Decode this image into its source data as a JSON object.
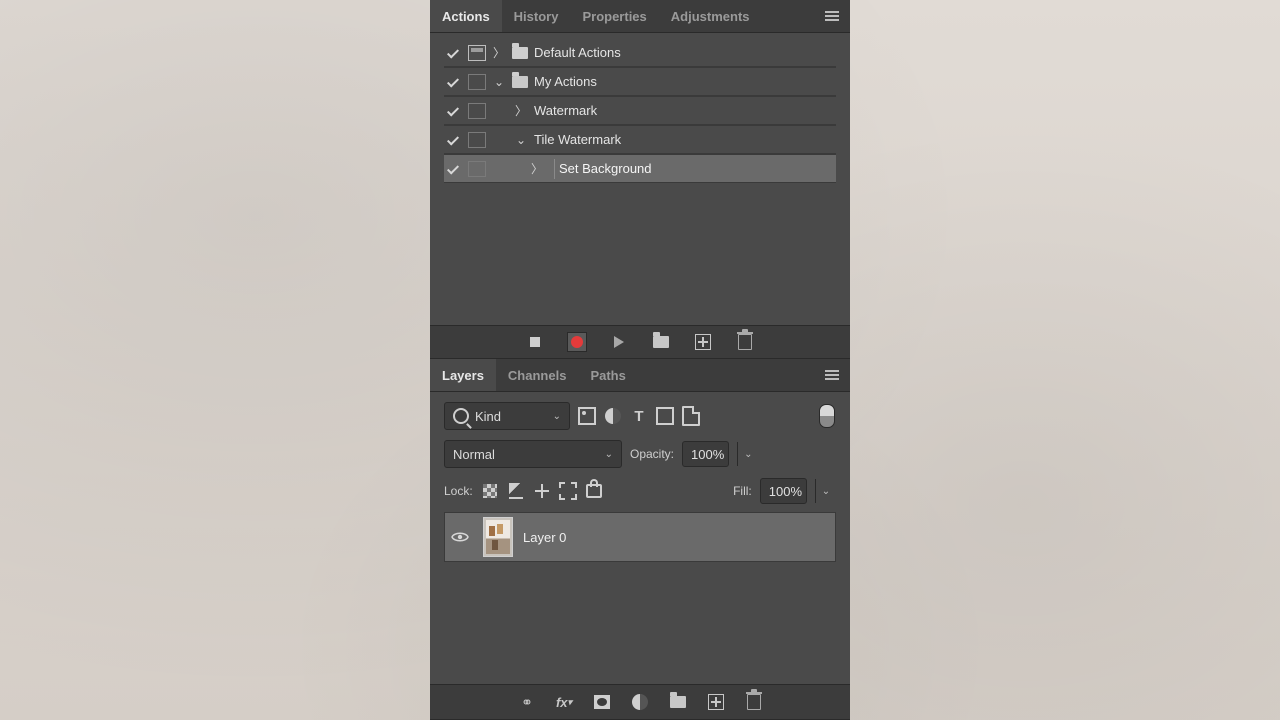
{
  "actions_panel": {
    "tabs": [
      "Actions",
      "History",
      "Properties",
      "Adjustments"
    ],
    "active_tab": "Actions",
    "tree": {
      "default_set": "Default Actions",
      "my_set": "My Actions",
      "watermark": "Watermark",
      "tile_watermark": "Tile Watermark",
      "set_background": "Set Background"
    },
    "footer_icons": [
      "stop",
      "record",
      "play",
      "new-set",
      "new-action",
      "delete"
    ]
  },
  "layers_panel": {
    "tabs": [
      "Layers",
      "Channels",
      "Paths"
    ],
    "active_tab": "Layers",
    "filter": {
      "label": "Kind"
    },
    "blend_mode": "Normal",
    "opacity_label": "Opacity:",
    "opacity_value": "100%",
    "lock_label": "Lock:",
    "fill_label": "Fill:",
    "fill_value": "100%",
    "layers": [
      {
        "name": "Layer 0",
        "visible": true
      }
    ],
    "footer_icons": [
      "link",
      "fx",
      "mask",
      "adjustment",
      "group",
      "new-layer",
      "delete"
    ]
  }
}
